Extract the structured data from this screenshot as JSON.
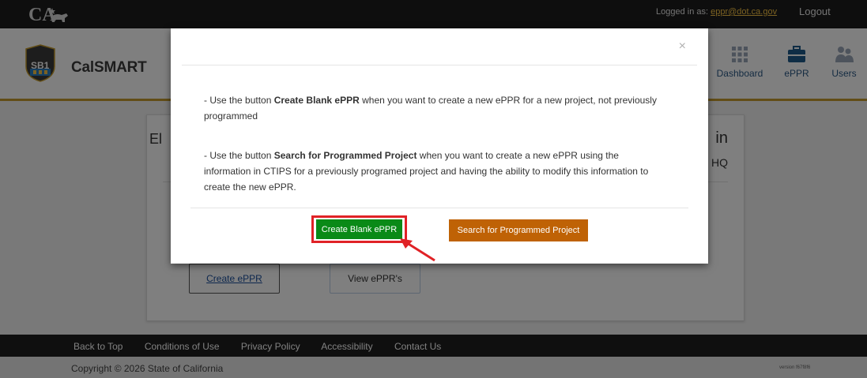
{
  "topbar": {
    "logged_in_label": "Logged in as:",
    "user_email": "eppr@dot.ca.gov",
    "logout_label": "Logout"
  },
  "header": {
    "badge_text": "SB1",
    "brand": "CalSMART",
    "nav": [
      {
        "label": "Dashboard",
        "icon": "grid-icon"
      },
      {
        "label": "ePPR",
        "icon": "briefcase-icon"
      },
      {
        "label": "Users",
        "icon": "users-icon"
      }
    ]
  },
  "card": {
    "title_left_fragment": "El",
    "title_right_fragment": "in",
    "sub_right_fragment": "HQ",
    "create_eppr_label": "Create ePPR",
    "view_eppr_label": "View ePPR's"
  },
  "modal": {
    "close_symbol": "×",
    "p1_prefix": "- Use the button ",
    "p1_bold": "Create Blank ePPR",
    "p1_suffix": " when you want to create a new ePPR for a new project, not previously programmed",
    "p2_prefix": "- Use the button ",
    "p2_bold": "Search for Programmed Project",
    "p2_suffix": " when you want to create a new ePPR using the information in CTIPS for a previously programed project and having the ability to modify this information to create the new ePPR.",
    "btn_blank_label": "Create Blank ePPR",
    "btn_search_label": "Search for Programmed Project"
  },
  "footer": {
    "links": [
      "Back to Top",
      "Conditions of Use",
      "Privacy Policy",
      "Accessibility",
      "Contact Us"
    ],
    "copyright": "Copyright © 2026 State of California",
    "version": "version f67f8f6"
  },
  "colors": {
    "accent_gold": "#c49a2c",
    "nav_blue": "#2a5885",
    "create_green": "#0a8a17",
    "search_orange": "#bf6205",
    "highlight_red": "#e02226"
  }
}
